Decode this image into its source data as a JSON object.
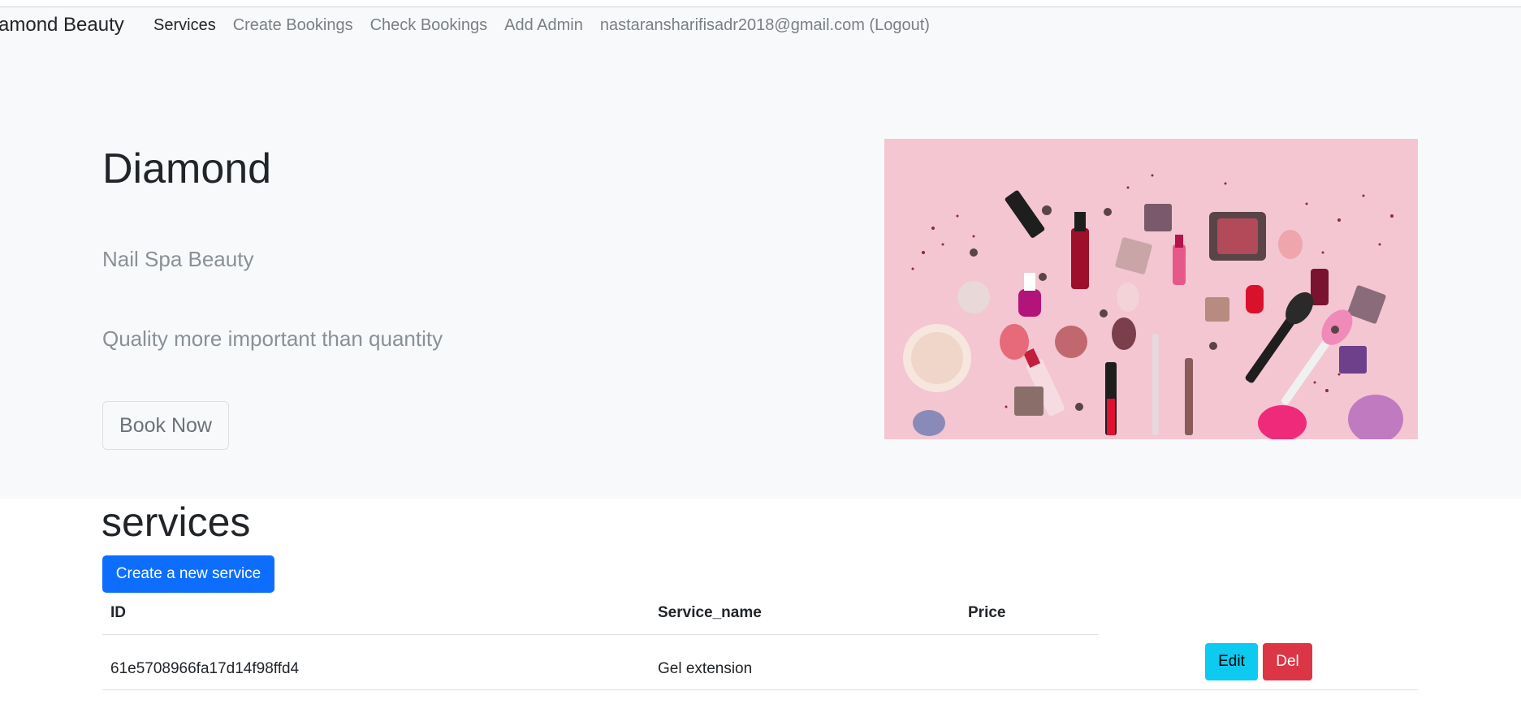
{
  "navbar": {
    "brand": "amond Beauty",
    "links": [
      {
        "label": "Services"
      },
      {
        "label": "Create Bookings"
      },
      {
        "label": "Check Bookings"
      },
      {
        "label": "Add Admin"
      },
      {
        "label": "nastaransharifisadr2018@gmail.com (Logout)"
      }
    ]
  },
  "hero": {
    "title": "Diamond",
    "subtitle": "Nail Spa Beauty",
    "tagline": "Quality more important than quantity",
    "book_button": "Book Now",
    "image_subject": "cosmetics-flat-lay"
  },
  "services": {
    "title": "services",
    "create_button": "Create a new service",
    "columns": [
      "ID",
      "Service_name",
      "Price"
    ],
    "rows": [
      {
        "id": "61e5708966fa17d14f98ffd4",
        "service_name": "Gel extension",
        "price": "",
        "edit_label": "Edit",
        "delete_label": "Del"
      }
    ]
  },
  "colors": {
    "hero_bg": "#f8f9fa",
    "primary": "#0d6efd",
    "info": "#0dcaf0",
    "danger": "#dc3545",
    "image_bg": "#f2c4d0"
  }
}
